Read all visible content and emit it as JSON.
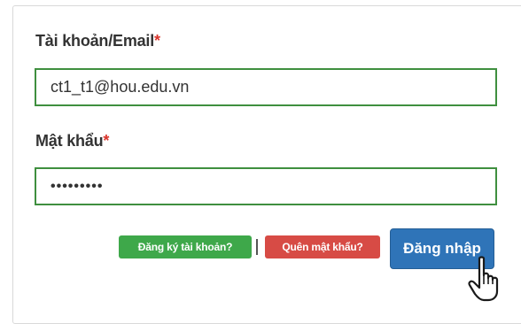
{
  "form": {
    "account_label": "Tài khoản/Email",
    "account_required": "*",
    "account_value": "ct1_t1@hou.edu.vn",
    "password_label": "Mật khẩu",
    "password_required": "*",
    "password_mask": "•••••••••",
    "register_label": "Đăng ký tài khoản?",
    "separator": "|",
    "forgot_label": "Quên mật khẩu?",
    "login_label": "Đăng nhập"
  },
  "colors": {
    "input_border": "#3f8f3f",
    "register_bg": "#3ea84a",
    "forgot_bg": "#d74b45",
    "login_bg": "#2f74b8",
    "required": "#d9342b"
  },
  "icons": {
    "cursor": "hand-pointer-icon"
  }
}
